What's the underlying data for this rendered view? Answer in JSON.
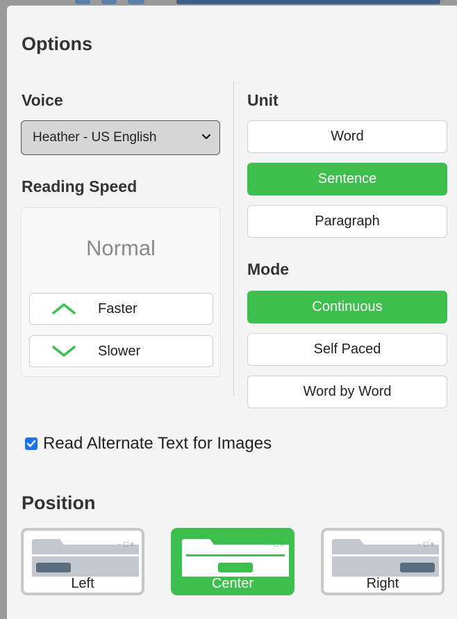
{
  "options": {
    "title": "Options"
  },
  "voice": {
    "label": "Voice",
    "selected": "Heather - US English"
  },
  "speed": {
    "label": "Reading Speed",
    "value": "Normal",
    "faster_label": "Faster",
    "slower_label": "Slower",
    "faster_icon": "chevron-up-icon",
    "slower_icon": "chevron-down-icon"
  },
  "unit": {
    "label": "Unit",
    "items": [
      {
        "label": "Word",
        "active": false
      },
      {
        "label": "Sentence",
        "active": true
      },
      {
        "label": "Paragraph",
        "active": false
      }
    ]
  },
  "mode": {
    "label": "Mode",
    "items": [
      {
        "label": "Continuous",
        "active": true
      },
      {
        "label": "Self Paced",
        "active": false
      },
      {
        "label": "Word by Word",
        "active": false
      }
    ]
  },
  "alt_text": {
    "label": "Read Alternate Text for Images",
    "checked": true
  },
  "position": {
    "label": "Position",
    "items": [
      {
        "label": "Left",
        "active": false
      },
      {
        "label": "Center",
        "active": true
      },
      {
        "label": "Right",
        "active": false
      }
    ]
  },
  "colors": {
    "accent": "#3dbf4e",
    "checkbox": "#1a73e8"
  }
}
